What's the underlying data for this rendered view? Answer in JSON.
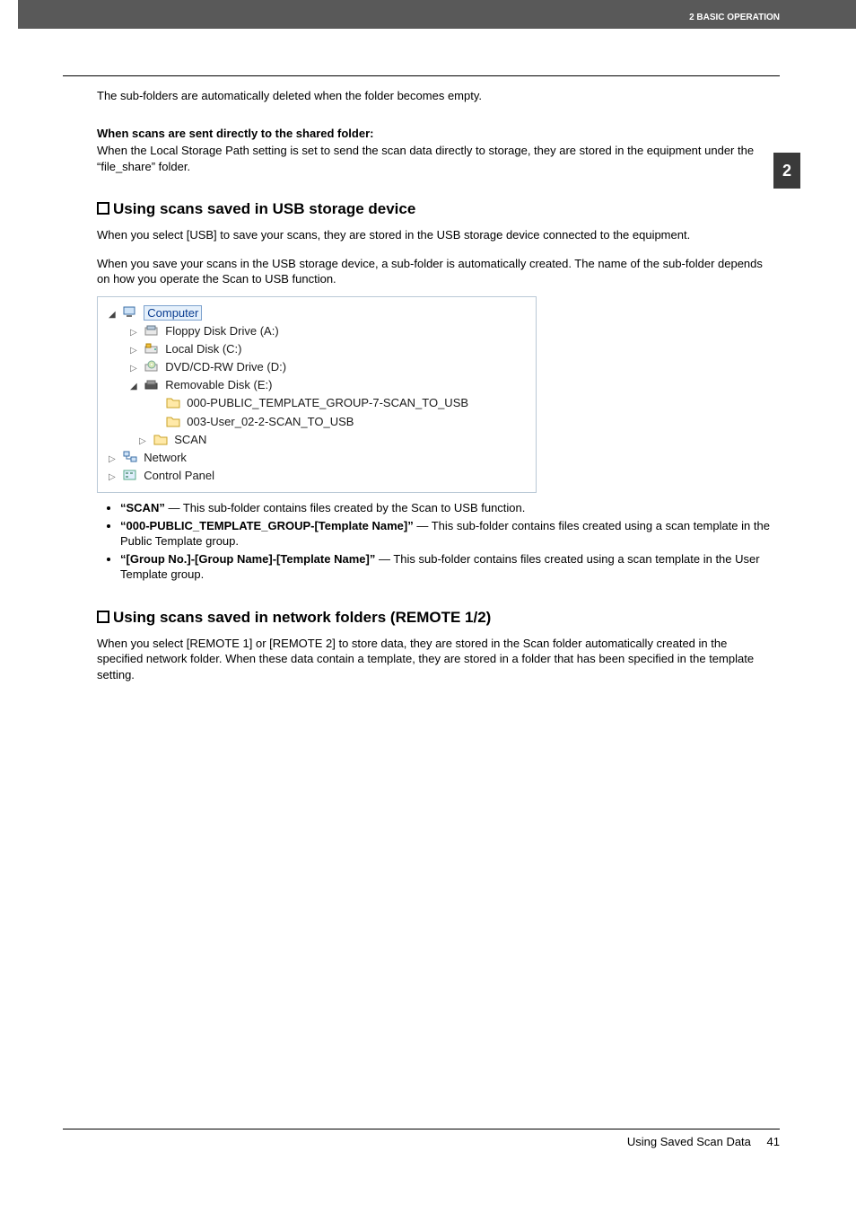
{
  "header": {
    "chapter_label": "2 BASIC OPERATION",
    "side_tab": "2"
  },
  "intro": {
    "p1": "The sub-folders are automatically deleted when the folder becomes empty.",
    "shared_h": "When scans are sent directly to the shared folder:",
    "shared_p": "When the Local Storage Path setting is set to send the scan data directly to storage, they are stored in the equipment under the “file_share” folder."
  },
  "usb": {
    "heading": "Using scans saved in USB storage device",
    "p1": "When you select [USB] to save your scans, they are stored in the USB storage device connected to the equipment.",
    "p2": "When you save your scans in the USB storage device, a sub-folder is automatically created. The name of the sub-folder depends on how you operate the Scan to USB function.",
    "tree": {
      "computer": "Computer",
      "floppy": "Floppy Disk Drive (A:)",
      "local": "Local Disk (C:)",
      "dvd": "DVD/CD-RW Drive (D:)",
      "removable": "Removable Disk (E:)",
      "f1": "000-PUBLIC_TEMPLATE_GROUP-7-SCAN_TO_USB",
      "f2": "003-User_02-2-SCAN_TO_USB",
      "f3": "SCAN",
      "network": "Network",
      "control": "Control Panel"
    },
    "bullets": {
      "b1_bold": "“SCAN”",
      "b1_rest": " — This sub-folder contains files created by the Scan to USB function.",
      "b2_bold": "“000-PUBLIC_TEMPLATE_GROUP-[Template Name]”",
      "b2_rest": " — This sub-folder contains files created using a scan template in the Public Template group.",
      "b3_bold": "“[Group No.]-[Group Name]-[Template Name]”",
      "b3_rest": " — This sub-folder contains files created using a scan template in the User Template group."
    }
  },
  "network": {
    "heading": "Using scans saved in network folders (REMOTE 1/2)",
    "p1": "When you select [REMOTE 1] or [REMOTE 2] to store data, they are stored in the Scan folder automatically created in the specified network folder. When these data contain a template, they are stored in a folder that has been specified in the template setting."
  },
  "footer": {
    "title": "Using Saved Scan Data",
    "page": "41"
  }
}
